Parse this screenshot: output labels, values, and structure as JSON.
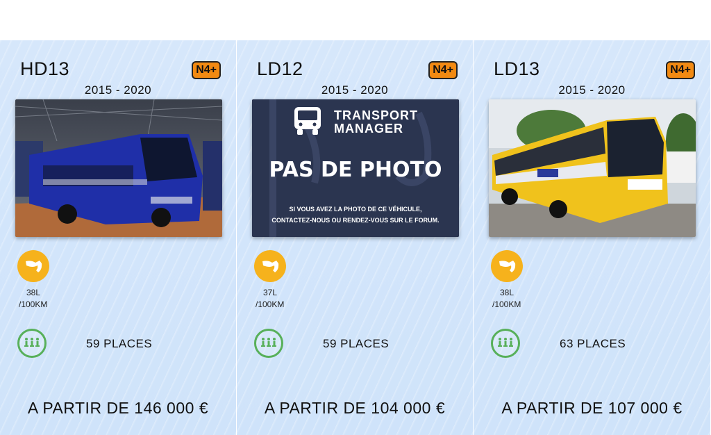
{
  "cards": [
    {
      "model": "HD13",
      "badge": "N4+",
      "years": "2015 - 2020",
      "fuel_value": "38L",
      "fuel_unit": "/100KM",
      "seats": "59 PLACES",
      "price": "A PARTIR DE 146 000 €",
      "photo": "bus-photo-blue-coach"
    },
    {
      "model": "LD12",
      "badge": "N4+",
      "years": "2015 - 2020",
      "fuel_value": "37L",
      "fuel_unit": "/100KM",
      "seats": "59 PLACES",
      "price": "A PARTIR DE 104 000 €",
      "photo": "no-photo-placeholder",
      "placeholder": {
        "brand_line1": "TRANSPORT",
        "brand_line2": "MANAGER",
        "title": "PAS DE PHOTO",
        "line1": "SI VOUS AVEZ LA PHOTO DE CE VÉHICULE,",
        "line2": "CONTACTEZ-NOUS OU RENDEZ-VOUS SUR LE FORUM."
      }
    },
    {
      "model": "LD13",
      "badge": "N4+",
      "years": "2015 - 2020",
      "fuel_value": "38L",
      "fuel_unit": "/100KM",
      "seats": "63 PLACES",
      "price": "A PARTIR DE 107 000 €",
      "photo": "bus-photo-yellow-intercity"
    }
  ],
  "colors": {
    "card_bg": "#d4e6fb",
    "badge": "#f28a12",
    "fuel_icon": "#f6b21c",
    "seats_ring": "#58b05a",
    "placeholder_bg": "#2b3550"
  },
  "icons": [
    "fuel-pump-icon",
    "passenger-seats-icon",
    "bus-icon"
  ]
}
